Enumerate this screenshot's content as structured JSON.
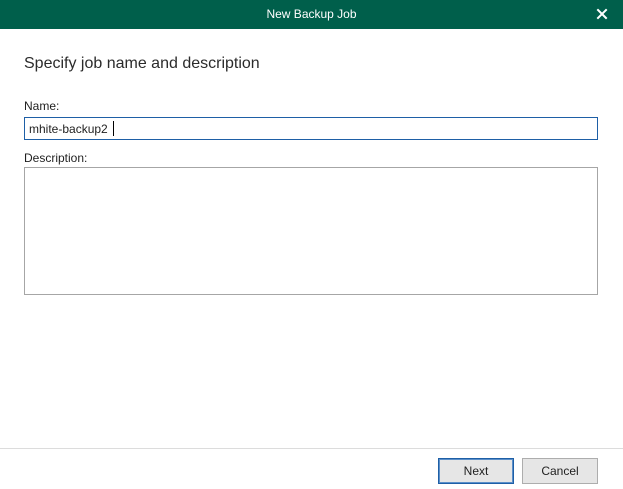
{
  "window": {
    "title": "New Backup Job",
    "close_icon": "close-icon",
    "titlebar_color": "#005f4b"
  },
  "content": {
    "heading": "Specify job name and description",
    "name_label": "Name:",
    "name_value": "mhite-backup2",
    "description_label": "Description:",
    "description_value": ""
  },
  "footer": {
    "next_label": "Next",
    "cancel_label": "Cancel"
  }
}
